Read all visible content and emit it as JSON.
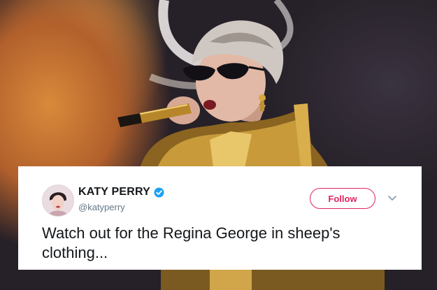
{
  "tweet": {
    "display_name": "KATY PERRY",
    "handle": "@katyperry",
    "follow_label": "Follow",
    "text": "Watch out for the Regina George in sheep's clothing...",
    "verified": true
  },
  "icons": {
    "verified": "verified-badge-icon",
    "menu": "chevron-down-icon"
  },
  "colors": {
    "follow_accent": "#e0245e",
    "verified_blue": "#1da1f2",
    "name_text": "#14171a",
    "handle_text": "#657786",
    "card_background": "#ffffff"
  }
}
